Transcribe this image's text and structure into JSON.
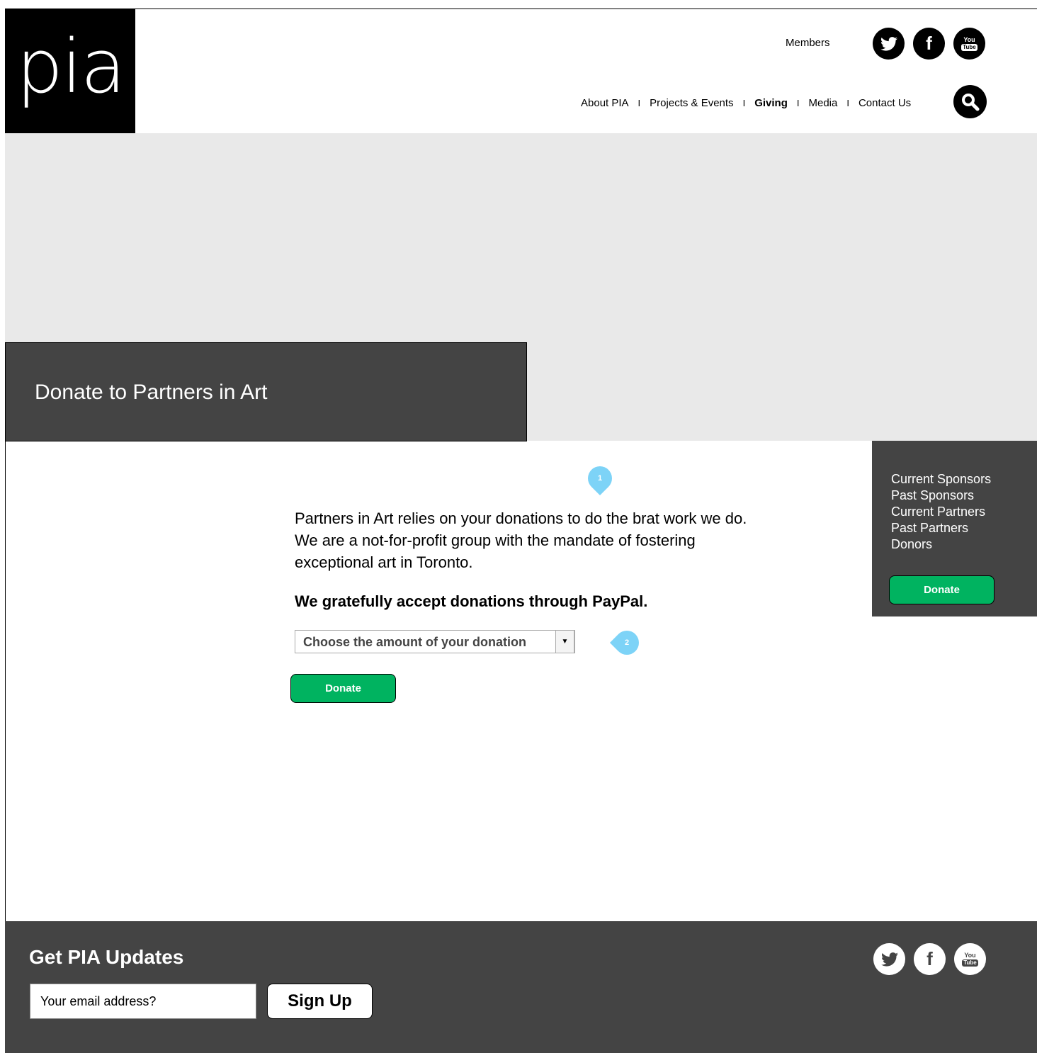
{
  "brand": {
    "logo_text": "pia"
  },
  "header": {
    "members_label": "Members",
    "social": [
      "twitter-icon",
      "facebook-icon",
      "youtube-icon"
    ],
    "youtube_text_top": "You",
    "youtube_text_bottom": "Tube",
    "facebook_text": "f"
  },
  "nav": {
    "items": [
      {
        "label": "About PIA"
      },
      {
        "label": "Projects & Events"
      },
      {
        "label": "Giving",
        "active": true
      },
      {
        "label": "Media"
      },
      {
        "label": "Contact Us"
      }
    ],
    "separator": "I"
  },
  "hero": {
    "title": "Donate to Partners in Art"
  },
  "sidebar": {
    "links": [
      "Current Sponsors",
      "Past Sponsors",
      "Current Partners",
      "Past Partners",
      "Donors"
    ],
    "donate_label": "Donate"
  },
  "main": {
    "intro": "Partners in Art relies on your donations to do the brat work we do. We are a not-for-profit group with the mandate of fostering exceptional art in Toronto.",
    "paypal_note": "We gratefully accept donations through PayPal.",
    "amount_select": "Choose the amount of your donation",
    "donate_label": "Donate",
    "annotation_1": "1",
    "annotation_2": "2"
  },
  "footer": {
    "title": "Get PIA Updates",
    "email_placeholder": "Your email address?",
    "signup_label": "Sign Up"
  },
  "colors": {
    "accent_green": "#00b360",
    "dark_panel": "#444444",
    "hero_gray": "#e9e9e9",
    "annotation_blue": "#7dd3f7"
  }
}
